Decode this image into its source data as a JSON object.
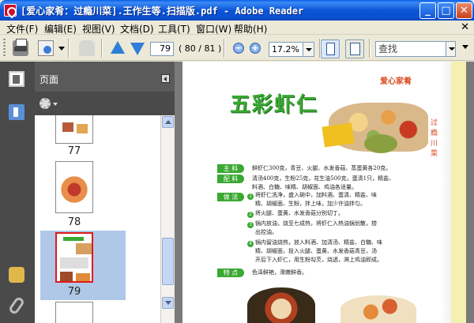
{
  "window": {
    "title": "[爱心家肴：过瘾川菜].王作生等.扫描版.pdf - Adobe Reader",
    "minimize_symbol": "_",
    "maximize_symbol": "□",
    "close_symbol": "✕"
  },
  "menu": {
    "items": [
      "文件(F)",
      "编辑(E)",
      "视图(V)",
      "文档(D)",
      "工具(T)",
      "窗口(W)",
      "帮助(H)"
    ],
    "doc_close": "✕"
  },
  "toolbar": {
    "current_page": "79",
    "page_count": "( 80 / 81 )",
    "zoom_out_symbol": "−",
    "zoom_in_symbol": "+",
    "zoom": "17.2%",
    "search_placeholder": "查找"
  },
  "panel": {
    "title": "页面",
    "thumbnails": [
      {
        "label": "77",
        "selected": false
      },
      {
        "label": "78",
        "selected": false
      },
      {
        "label": "79",
        "selected": true
      }
    ]
  },
  "document": {
    "header_tag": "爱心家肴",
    "side_title": "过瘾川菜",
    "dish_title": "五彩虾仁",
    "ingredients": [
      {
        "label": "主 料",
        "text": "鲜虾仁300克，青豆、火腿、水发香菇、蒸蛋黄各20克。"
      },
      {
        "label": "配 料",
        "text": "清汤400克，生粉25克，花生油500克，蛋清1只，精盐、"
      },
      {
        "label": "",
        "text": "料酒、白糖、味精、胡椒面、鸡油各适量。"
      }
    ],
    "method_label": "做 法",
    "steps": [
      {
        "num": "1",
        "lines": [
          "将虾仁洗净，盛入碗中，加料酒、蛋清、精盐、味",
          "精、胡椒面、生粉，拌上味，加少许油拌匀。"
        ]
      },
      {
        "num": "2",
        "lines": [
          "将火腿、蛋黄、水发香菇分别切丁。"
        ]
      },
      {
        "num": "3",
        "lines": [
          "锅内放油，烧至七成热，将虾仁入热油锅划散，捞",
          "出控油。"
        ]
      },
      {
        "num": "4",
        "lines": [
          "锅内留油烧热，放入料酒、加清汤、精盐、白糖、味",
          "精、胡椒面，投入火腿、蛋黄、水发香菇青豆，汤",
          "开后下入虾仁，用生粉勾芡，烧透，淋上鸡油即成。"
        ]
      }
    ],
    "feature_label": "特 点",
    "feature_text": "色泽鲜艳，滑嫩鲜香。"
  },
  "colors": {
    "accent_green": "#3aa832",
    "accent_orange": "#d84a1e",
    "titlebar_blue": "#0b56d8"
  }
}
